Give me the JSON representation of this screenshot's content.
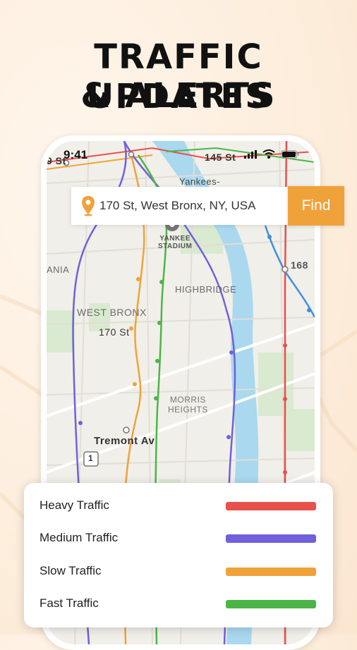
{
  "headline": {
    "line1": "TRAFFIC UPDATES",
    "line2": "& ALERTS"
  },
  "status_bar": {
    "time": "9:41"
  },
  "search": {
    "value": "170 St, West Bronx, NY, USA",
    "button_label": "Find"
  },
  "map_labels": {
    "st_145": "145 St",
    "st_left": "9 St",
    "yankees": "Yankees-",
    "yankee_stadium_1": "YANKEE",
    "yankee_stadium_2": "STADIUM",
    "mania": "ANIA",
    "st_168": "168",
    "highbridge": "HIGHBRIDGE",
    "west_bronx": "WEST BRONX",
    "st_170": "170 St",
    "morris_1": "MORRIS",
    "morris_2": "HEIGHTS",
    "tremont": "Tremont Av",
    "route_1": "1"
  },
  "legend": {
    "items": [
      {
        "label": "Heavy Traffic",
        "color": "#e8504a"
      },
      {
        "label": "Medium Traffic",
        "color": "#7160dc"
      },
      {
        "label": "Slow Traffic",
        "color": "#f0a23a"
      },
      {
        "label": "Fast Traffic",
        "color": "#4cb548"
      }
    ]
  },
  "colors": {
    "accent": "#f0a23a",
    "heavy": "#e8504a",
    "medium": "#7160dc",
    "slow": "#f0a23a",
    "fast": "#4cb548",
    "water": "#a9d8ef"
  },
  "icons": [
    "location-pin-icon",
    "cellular-signal-icon",
    "wifi-icon",
    "battery-icon",
    "stadium-marker-icon"
  ]
}
